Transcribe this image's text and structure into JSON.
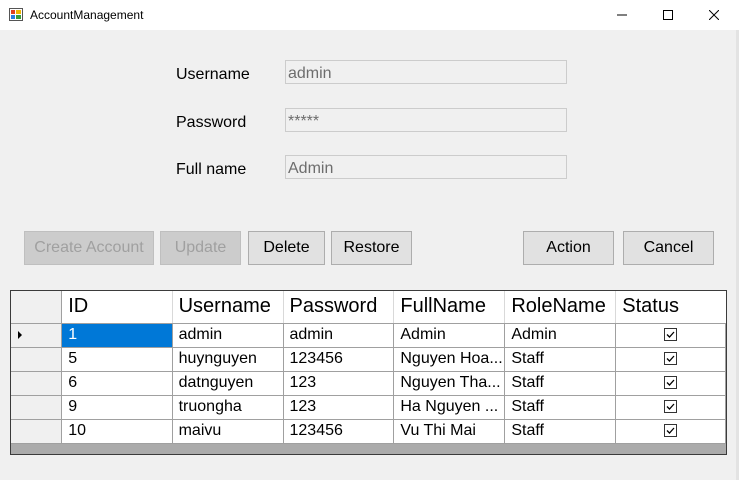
{
  "window": {
    "title": "AccountManagement"
  },
  "form": {
    "username": {
      "label": "Username",
      "value": "admin"
    },
    "password": {
      "label": "Password",
      "value": "*****"
    },
    "fullname": {
      "label": "Full name",
      "value": "Admin"
    }
  },
  "buttons": {
    "create": "Create Account",
    "update": "Update",
    "delete": "Delete",
    "restore": "Restore",
    "action": "Action",
    "cancel": "Cancel"
  },
  "table": {
    "columns": [
      "ID",
      "Username",
      "Password",
      "FullName",
      "RoleName",
      "Status"
    ],
    "rows": [
      {
        "id": "1",
        "username": "admin",
        "password": "admin",
        "fullname": "Admin",
        "role": "Admin",
        "status": true
      },
      {
        "id": "5",
        "username": "huynguyen",
        "password": "123456",
        "fullname": "Nguyen Hoa...",
        "role": "Staff",
        "status": true
      },
      {
        "id": "6",
        "username": "datnguyen",
        "password": "123",
        "fullname": "Nguyen Tha...",
        "role": "Staff",
        "status": true
      },
      {
        "id": "9",
        "username": "truongha",
        "password": "123",
        "fullname": "Ha Nguyen ...",
        "role": "Staff",
        "status": true
      },
      {
        "id": "10",
        "username": "maivu",
        "password": "123456",
        "fullname": "Vu Thi Mai",
        "role": "Staff",
        "status": true
      }
    ],
    "selected_row": 0
  },
  "colors": {
    "selection": "#0078d7",
    "disabled_button": "#cccccc"
  }
}
